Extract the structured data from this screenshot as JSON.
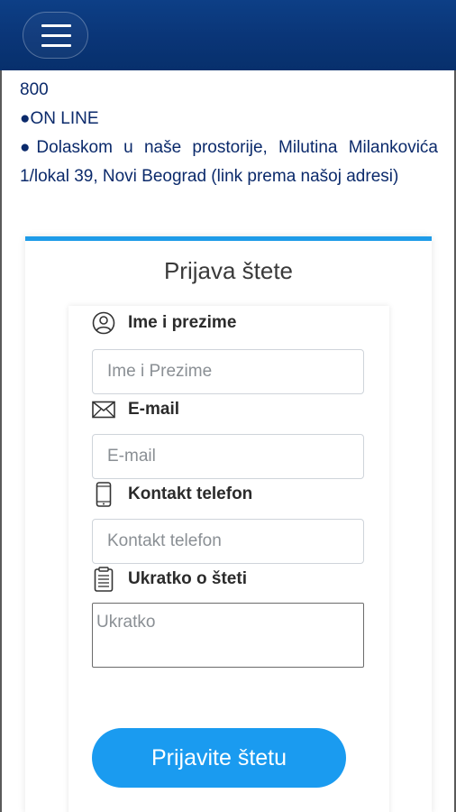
{
  "header": {
    "menu_icon": "hamburger-menu-icon",
    "color": "#0a3577"
  },
  "info": {
    "lines": [
      "800",
      "●ON LINE",
      "●Dolaskom u naše prostorije, Milutina Milankovića 1/lokal 39, Novi Beograd (link prema našoj adresi)"
    ]
  },
  "form": {
    "title": "Prijava štete",
    "fields": [
      {
        "label": "Ime i prezime",
        "placeholder": "Ime i Prezime",
        "icon": "user-circle-icon"
      },
      {
        "label": "E-mail",
        "placeholder": "E-mail",
        "icon": "envelope-icon"
      },
      {
        "label": "Kontakt telefon",
        "placeholder": "Kontakt telefon",
        "icon": "mobile-phone-icon"
      },
      {
        "label": "Ukratko o šteti",
        "placeholder": "Ukratko",
        "icon": "document-list-icon"
      }
    ],
    "submit_label": "Prijavite štetu",
    "accent_color": "#1e9be8"
  }
}
